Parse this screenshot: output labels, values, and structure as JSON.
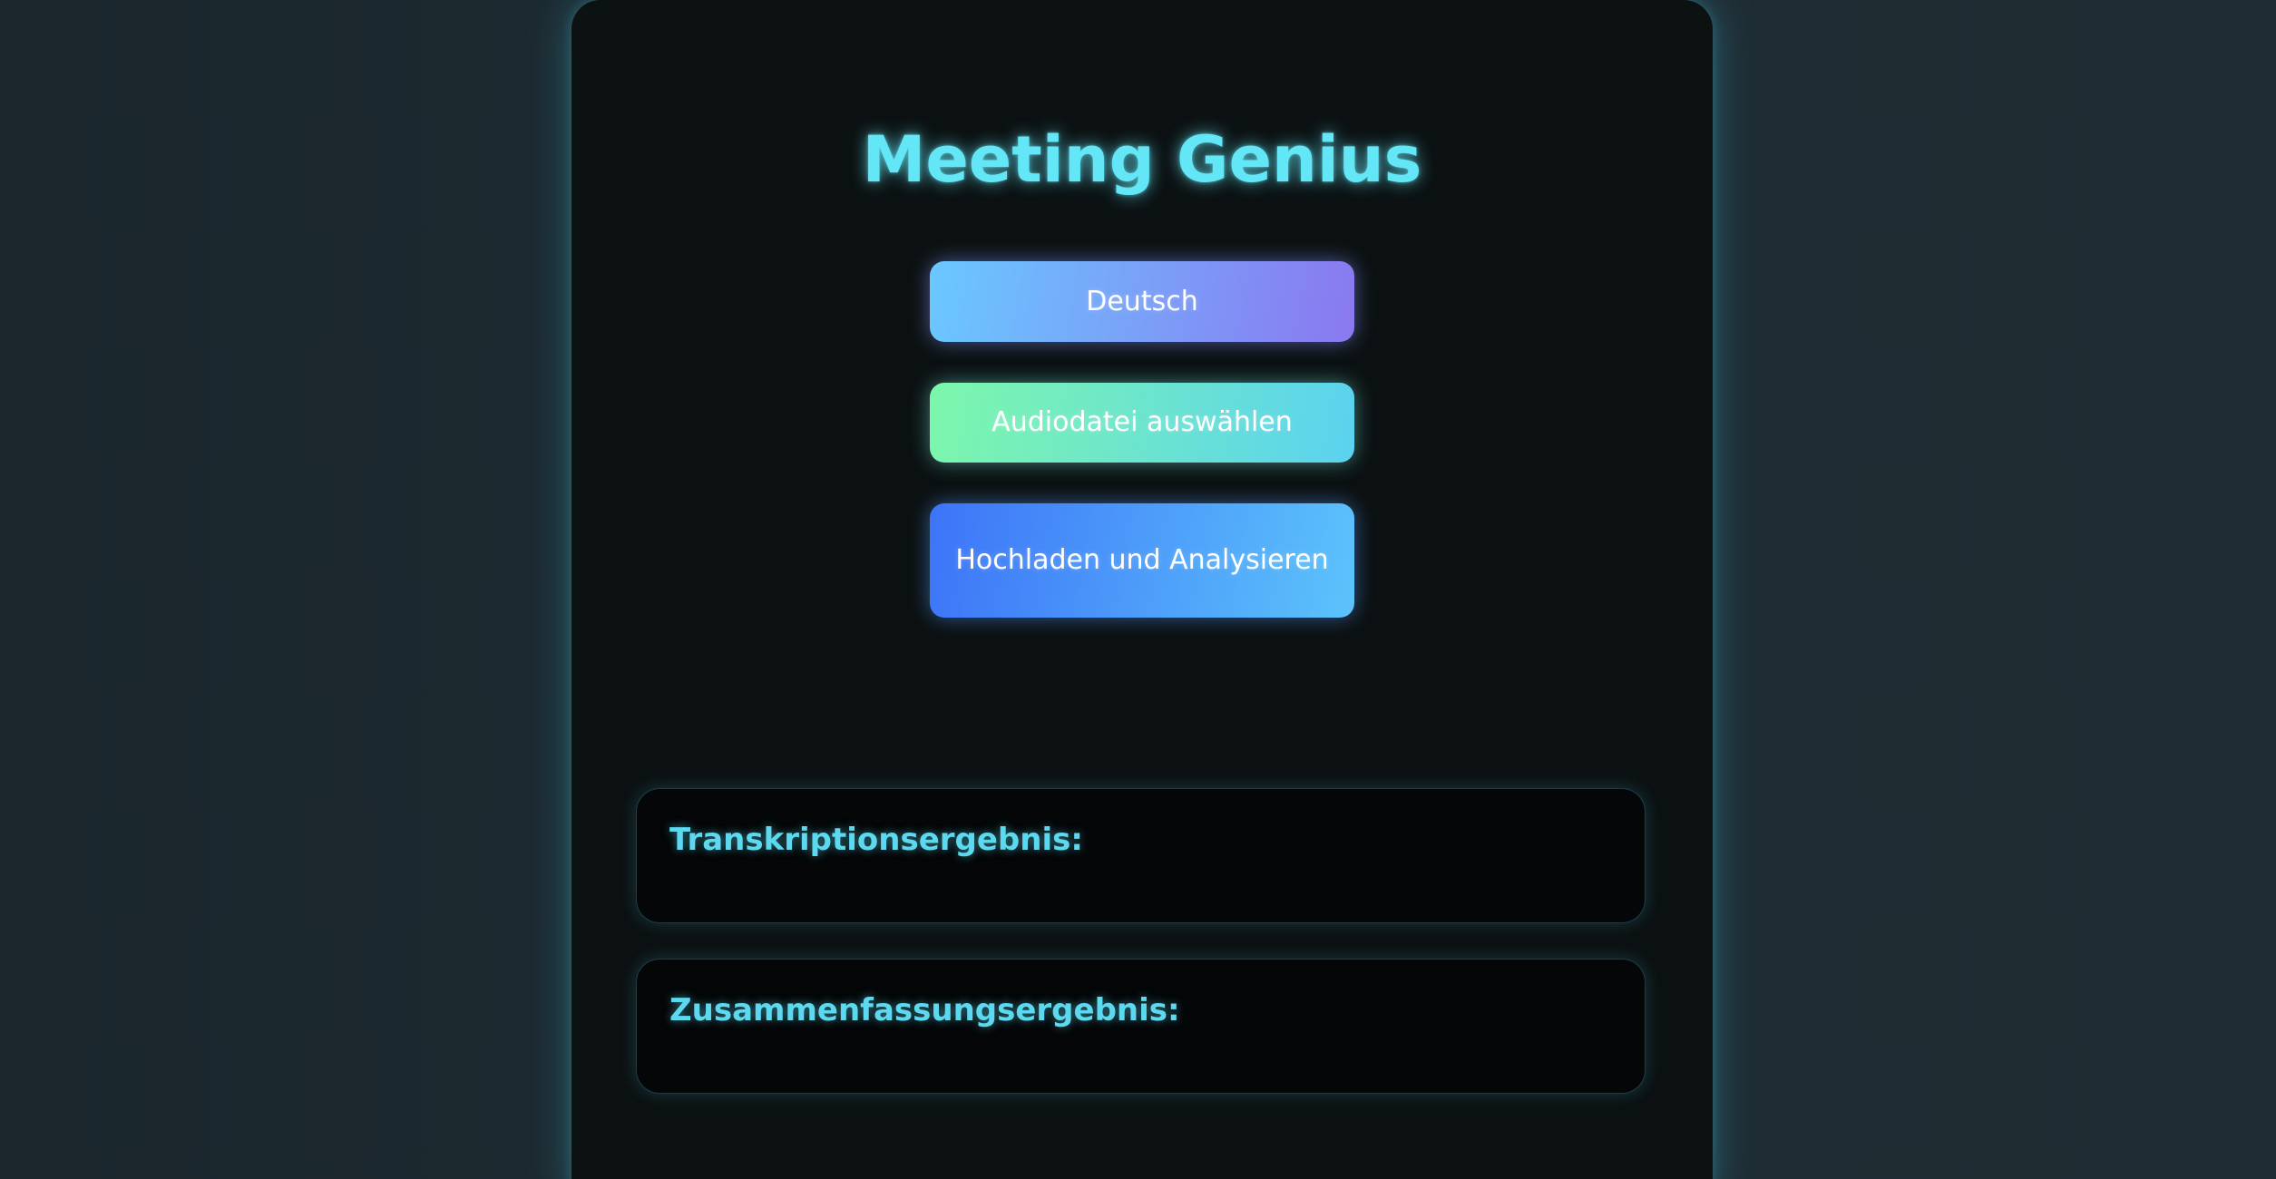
{
  "app": {
    "title": "Meeting Genius"
  },
  "controls": {
    "language_label": "Deutsch",
    "select_audio_label": "Audiodatei auswählen",
    "upload_analyze_label": "Hochladen und Analysieren"
  },
  "results": {
    "transcription_heading": "Transkriptionsergebnis:",
    "transcription_text": "",
    "summary_heading": "Zusammenfassungsergebnis:",
    "summary_text": ""
  },
  "colors": {
    "accent": "#63e6f6",
    "background": "#1d2a31",
    "card": "#0c1112"
  }
}
